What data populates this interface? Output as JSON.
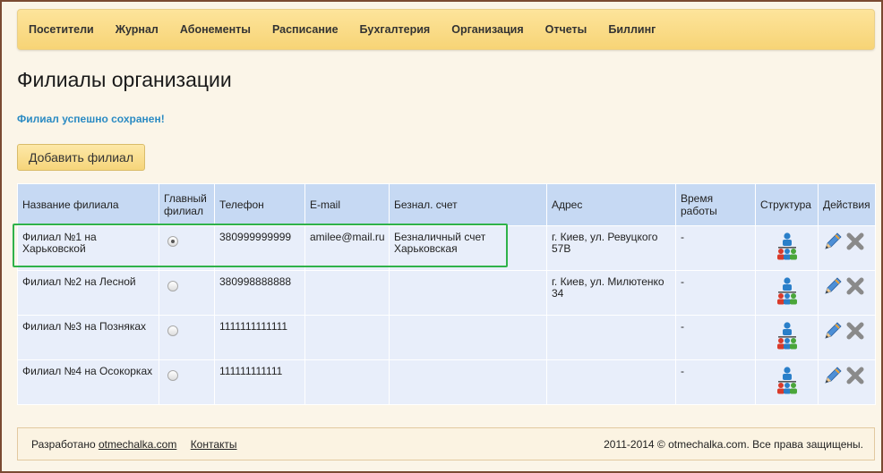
{
  "nav": {
    "items": [
      "Посетители",
      "Журнал",
      "Абонементы",
      "Расписание",
      "Бухгалтерия",
      "Организация",
      "Отчеты",
      "Биллинг"
    ]
  },
  "page": {
    "title": "Филиалы организации",
    "success_message": "Филиал успешно сохранен!",
    "add_button": "Добавить филиал"
  },
  "table": {
    "headers": {
      "name": "Название филиала",
      "main": "Главный филиал",
      "phone": "Телефон",
      "email": "E-mail",
      "account": "Безнал. счет",
      "address": "Адрес",
      "hours": "Время работы",
      "structure": "Структура",
      "actions": "Действия"
    },
    "rows": [
      {
        "name": "Филиал №1 на Харьковской",
        "main": true,
        "phone": "380999999999",
        "email": "amilee@mail.ru",
        "account": "Безналичный счет Харьковская",
        "address": "г. Киев, ул. Ревуцкого 57В",
        "hours": "-"
      },
      {
        "name": "Филиал №2 на Лесной",
        "main": false,
        "phone": "380998888888",
        "email": "",
        "account": "",
        "address": "г. Киев, ул. Милютенко 34",
        "hours": "-"
      },
      {
        "name": "Филиал №3 на Позняках",
        "main": false,
        "phone": "1111111111111",
        "email": "",
        "account": "",
        "address": "",
        "hours": "-"
      },
      {
        "name": "Филиал №4 на Осокорках",
        "main": false,
        "phone": "111111111111",
        "email": "",
        "account": "",
        "address": "",
        "hours": "-"
      }
    ]
  },
  "icons": {
    "structure": "org-structure-icon",
    "edit": "pencil-icon",
    "delete": "close-icon"
  },
  "footer": {
    "developed_by": "Разработано",
    "site_link": "otmechalka.com",
    "contacts_link": "Контакты",
    "copyright": "2011-2014 © otmechalka.com. Все права защищены."
  }
}
